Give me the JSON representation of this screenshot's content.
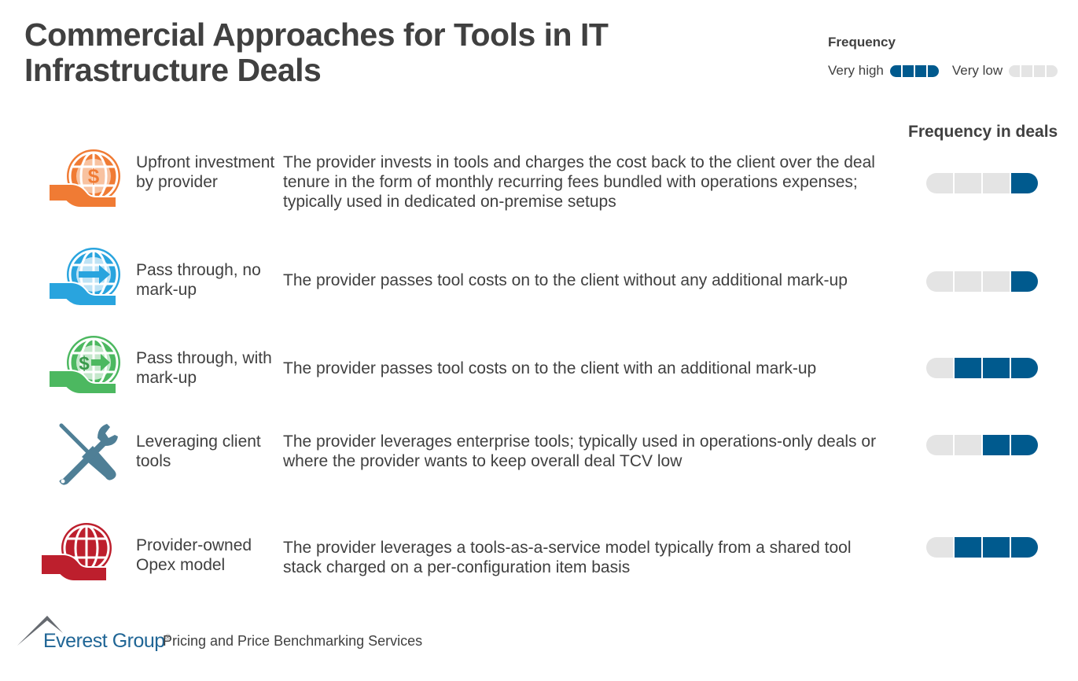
{
  "title": "Commercial Approaches for Tools in IT Infrastructure Deals",
  "legend": {
    "title": "Frequency",
    "high_label": "Very high",
    "high_level": 4,
    "low_label": "Very low",
    "low_level": 0,
    "max_level": 4
  },
  "frequency_header": "Frequency in deals",
  "colors": {
    "filled": "#005a8e",
    "empty": "#e4e4e4",
    "orange": "#f07b34",
    "blue": "#29a4de",
    "green": "#4cb860",
    "steel": "#4f7f96",
    "red": "#bd1f2d"
  },
  "rows": [
    {
      "icon": "hand-globe-dollar-icon",
      "name": "Upfront investment by provider",
      "description": "The provider invests in tools and charges the cost back to the client over the deal tenure in the form of monthly recurring fees bundled with operations expenses; typically used in dedicated on-premise setups",
      "frequency": 1
    },
    {
      "icon": "hand-globe-arrow-icon",
      "name": "Pass through, no mark-up",
      "description": "The provider passes tool costs on to the client without any additional mark-up",
      "frequency": 1
    },
    {
      "icon": "hand-globe-dollar-arrow-icon",
      "name": "Pass through, with mark-up",
      "description": "The provider passes tool costs on to the client with an additional mark-up",
      "frequency": 3
    },
    {
      "icon": "wrench-screwdriver-icon",
      "name": "Leveraging client tools",
      "description": "The provider leverages enterprise tools; typically used in operations-only deals or where the provider wants to keep overall deal TCV low",
      "frequency": 2
    },
    {
      "icon": "hand-globe-icon",
      "name": "Provider-owned Opex model",
      "description": "The provider leverages a tools-as-a-service model typically from a shared tool stack charged on a per-configuration item basis",
      "frequency": 3
    }
  ],
  "footer": {
    "brand": "Everest Group",
    "registered": "®",
    "service": "Pricing and Price Benchmarking Services"
  }
}
